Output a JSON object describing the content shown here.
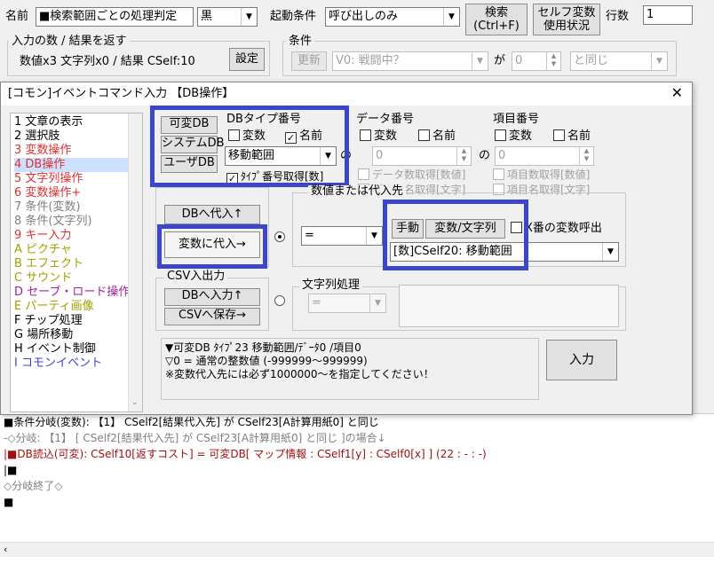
{
  "top": {
    "name_label": "名前",
    "name_value": "■検索範囲ごとの処理判定",
    "color_value": "黒",
    "trigger_label": "起動条件",
    "trigger_value": "呼び出しのみ",
    "search_btn": "検索\n(Ctrl+F)",
    "selfvar_btn": "セルフ変数\n使用状況",
    "lines_label": "行数",
    "lines_value": "1"
  },
  "io": {
    "group_label": "入力の数 / 結果を返す",
    "summary": "数値x3 文字列x0 / 結果 CSelf:10",
    "set_btn": "設定"
  },
  "cond": {
    "group_label": "条件",
    "update_btn": "更新",
    "var_value": "V0: 戦闘中？",
    "ga": "が",
    "num_value": "0",
    "op_value": "と同じ"
  },
  "dialog": {
    "title": "[コモン]イベントコマンド入力 【DB操作】",
    "close": "✕"
  },
  "commands": [
    {
      "label": "1 文章の表示",
      "color": "#000000"
    },
    {
      "label": "2 選択肢",
      "color": "#000000"
    },
    {
      "label": "3 変数操作",
      "color": "#e03030"
    },
    {
      "label": "4 DB操作",
      "color": "#e03030"
    },
    {
      "label": "5 文字列操作",
      "color": "#e03030"
    },
    {
      "label": "6 変数操作+",
      "color": "#e03030"
    },
    {
      "label": "7 条件(変数)",
      "color": "#808080"
    },
    {
      "label": "8 条件(文字列)",
      "color": "#808080"
    },
    {
      "label": "9 キー入力",
      "color": "#e03030"
    },
    {
      "label": "A ピクチャ",
      "color": "#a0a000"
    },
    {
      "label": "B エフェクト",
      "color": "#a0a000"
    },
    {
      "label": "C サウンド",
      "color": "#a0a000"
    },
    {
      "label": "D セーブ・ロード操作",
      "color": "#a020a0"
    },
    {
      "label": "E パーティ画像",
      "color": "#a0a000"
    },
    {
      "label": "F チップ処理",
      "color": "#000000"
    },
    {
      "label": "G 場所移動",
      "color": "#000000"
    },
    {
      "label": "H イベント制御",
      "color": "#000000"
    },
    {
      "label": "I コモンイベント",
      "color": "#4040e0"
    }
  ],
  "db": {
    "btn_var": "可変DB",
    "btn_sys": "システムDB",
    "btn_user": "ユーザDB",
    "type_label": "DBタイプ番号",
    "var_cb": "変数",
    "name_cb": "名前",
    "type_value": "移動範囲",
    "type_name_cb": "ﾀｲﾌﾟ番号取得[数]",
    "no": "の"
  },
  "data": {
    "label": "データ番号",
    "var_cb": "変数",
    "name_cb": "名前",
    "value": "0",
    "count_cb": "データ数取得[数値]",
    "name_get_cb": "データ名取得[文字]"
  },
  "item": {
    "label": "項目番号",
    "var_cb": "変数",
    "name_cb": "名前",
    "value": "0",
    "count_cb": "項目数取得[数値]",
    "name_get_cb": "項目名取得[文字]"
  },
  "ops": {
    "db_in": "DBへ代入↑",
    "var_in": "変数に代入→",
    "csv_label": "CSV入出力",
    "db_input": "DBへ入力↑",
    "csv_save": "CSVへ保存→",
    "assign_label": "数値または代入先",
    "op_value": "=",
    "manual": "手動",
    "var_str": "変数/文字列",
    "x_call": "X番の変数呼出",
    "target": "[数]CSelf20: 移動範囲",
    "str_label": "文字列処理",
    "str_op": "="
  },
  "info": {
    "line1": "▼可変DB ﾀｲﾌﾟ23 移動範囲/ﾃﾞｰﾀ0 /項目0",
    "line2": "▽0 = 通常の整数値 (-999999～999999)",
    "line3": "※変数代入先には必ず1000000～を指定してください！",
    "input_btn": "入力"
  },
  "script": [
    {
      "text": "■条件分岐(変数): 【1】 CSelf2[結果代入先] が CSelf23[A計算用紙0] と同じ",
      "color": "#000000"
    },
    {
      "text": "-◇分岐: 【1】 [ CSelf2[結果代入先] が CSelf23[A計算用紙0] と同じ ]の場合↓",
      "color": "#808080"
    },
    {
      "text": "|■DB読込(可変): CSelf10[返すコスト] = 可変DB[ マップ情報 : CSelf1[y] : CSelf0[x] ] (22 : - : -)",
      "color": "#a01010"
    },
    {
      "text": "|■",
      "color": "#000000"
    },
    {
      "text": "◇分岐終了◇",
      "color": "#808080"
    },
    {
      "text": "■",
      "color": "#000000"
    }
  ]
}
